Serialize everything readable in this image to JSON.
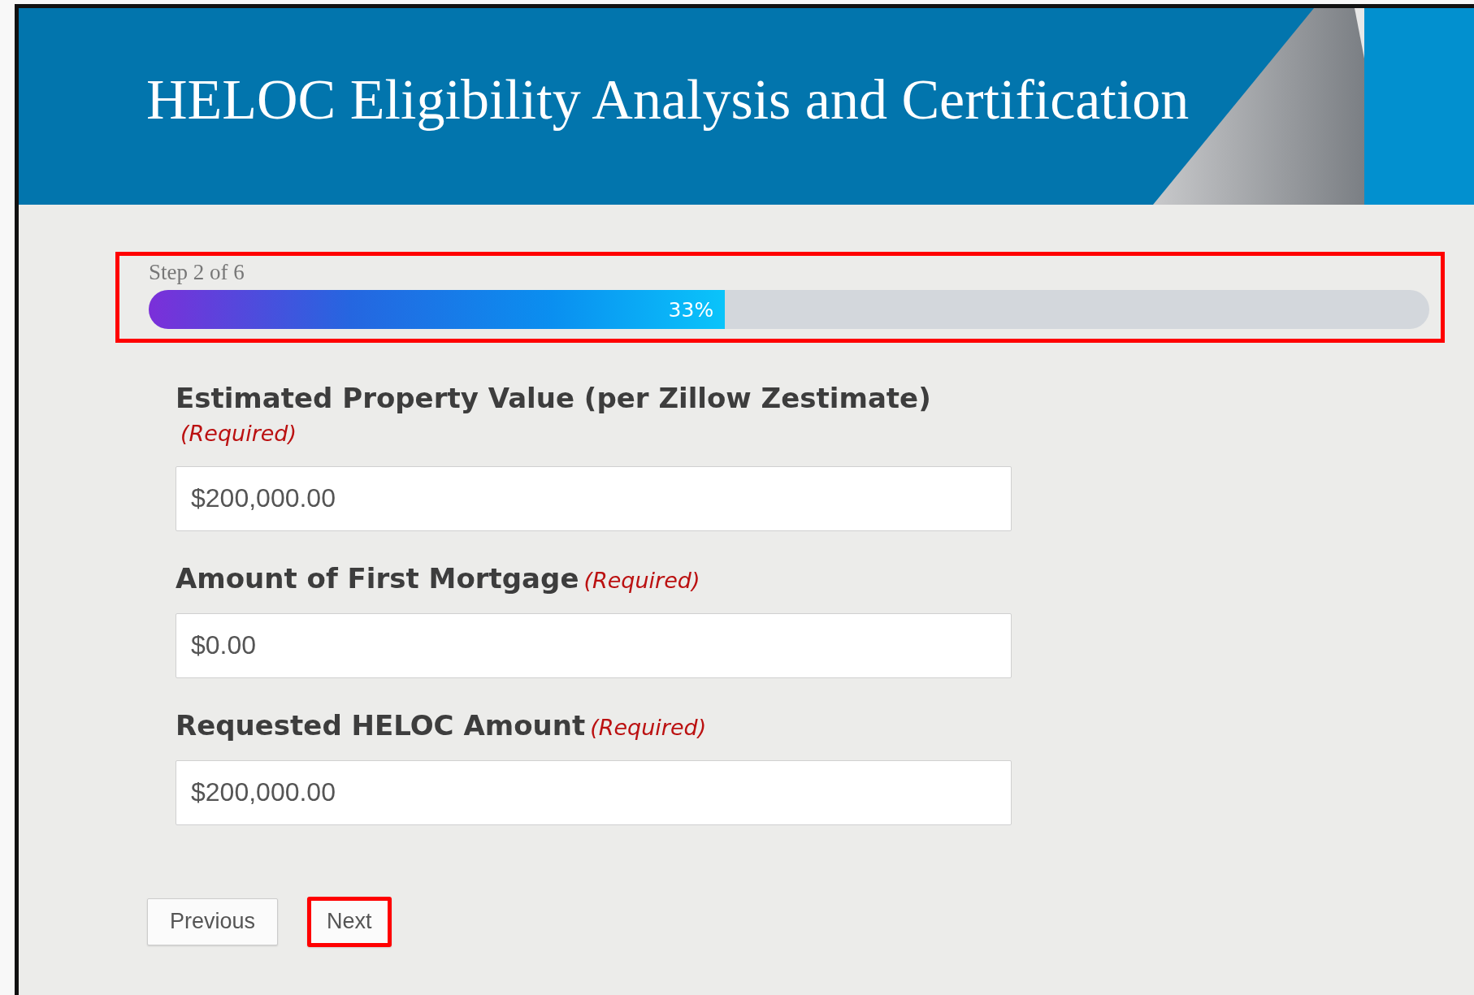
{
  "header": {
    "title": "HELOC Eligibility Analysis and Certification"
  },
  "progress": {
    "step_label": "Step 2 of 6",
    "level": 0.45,
    "percent_label": "33%",
    "highlighted": true
  },
  "fields": [
    {
      "label": "Estimated Property Value (per Zillow Zestimate)",
      "required_label": "(Required)",
      "value": "$200,000.00"
    },
    {
      "label": "Amount of First Mortgage",
      "required_label": "(Required)",
      "value": "$0.00"
    },
    {
      "label": "Requested HELOC Amount",
      "required_label": "(Required)",
      "value": "$200,000.00"
    }
  ],
  "buttons": [
    {
      "label": "Previous",
      "highlighted": false
    },
    {
      "label": "Next",
      "highlighted": true
    }
  ]
}
